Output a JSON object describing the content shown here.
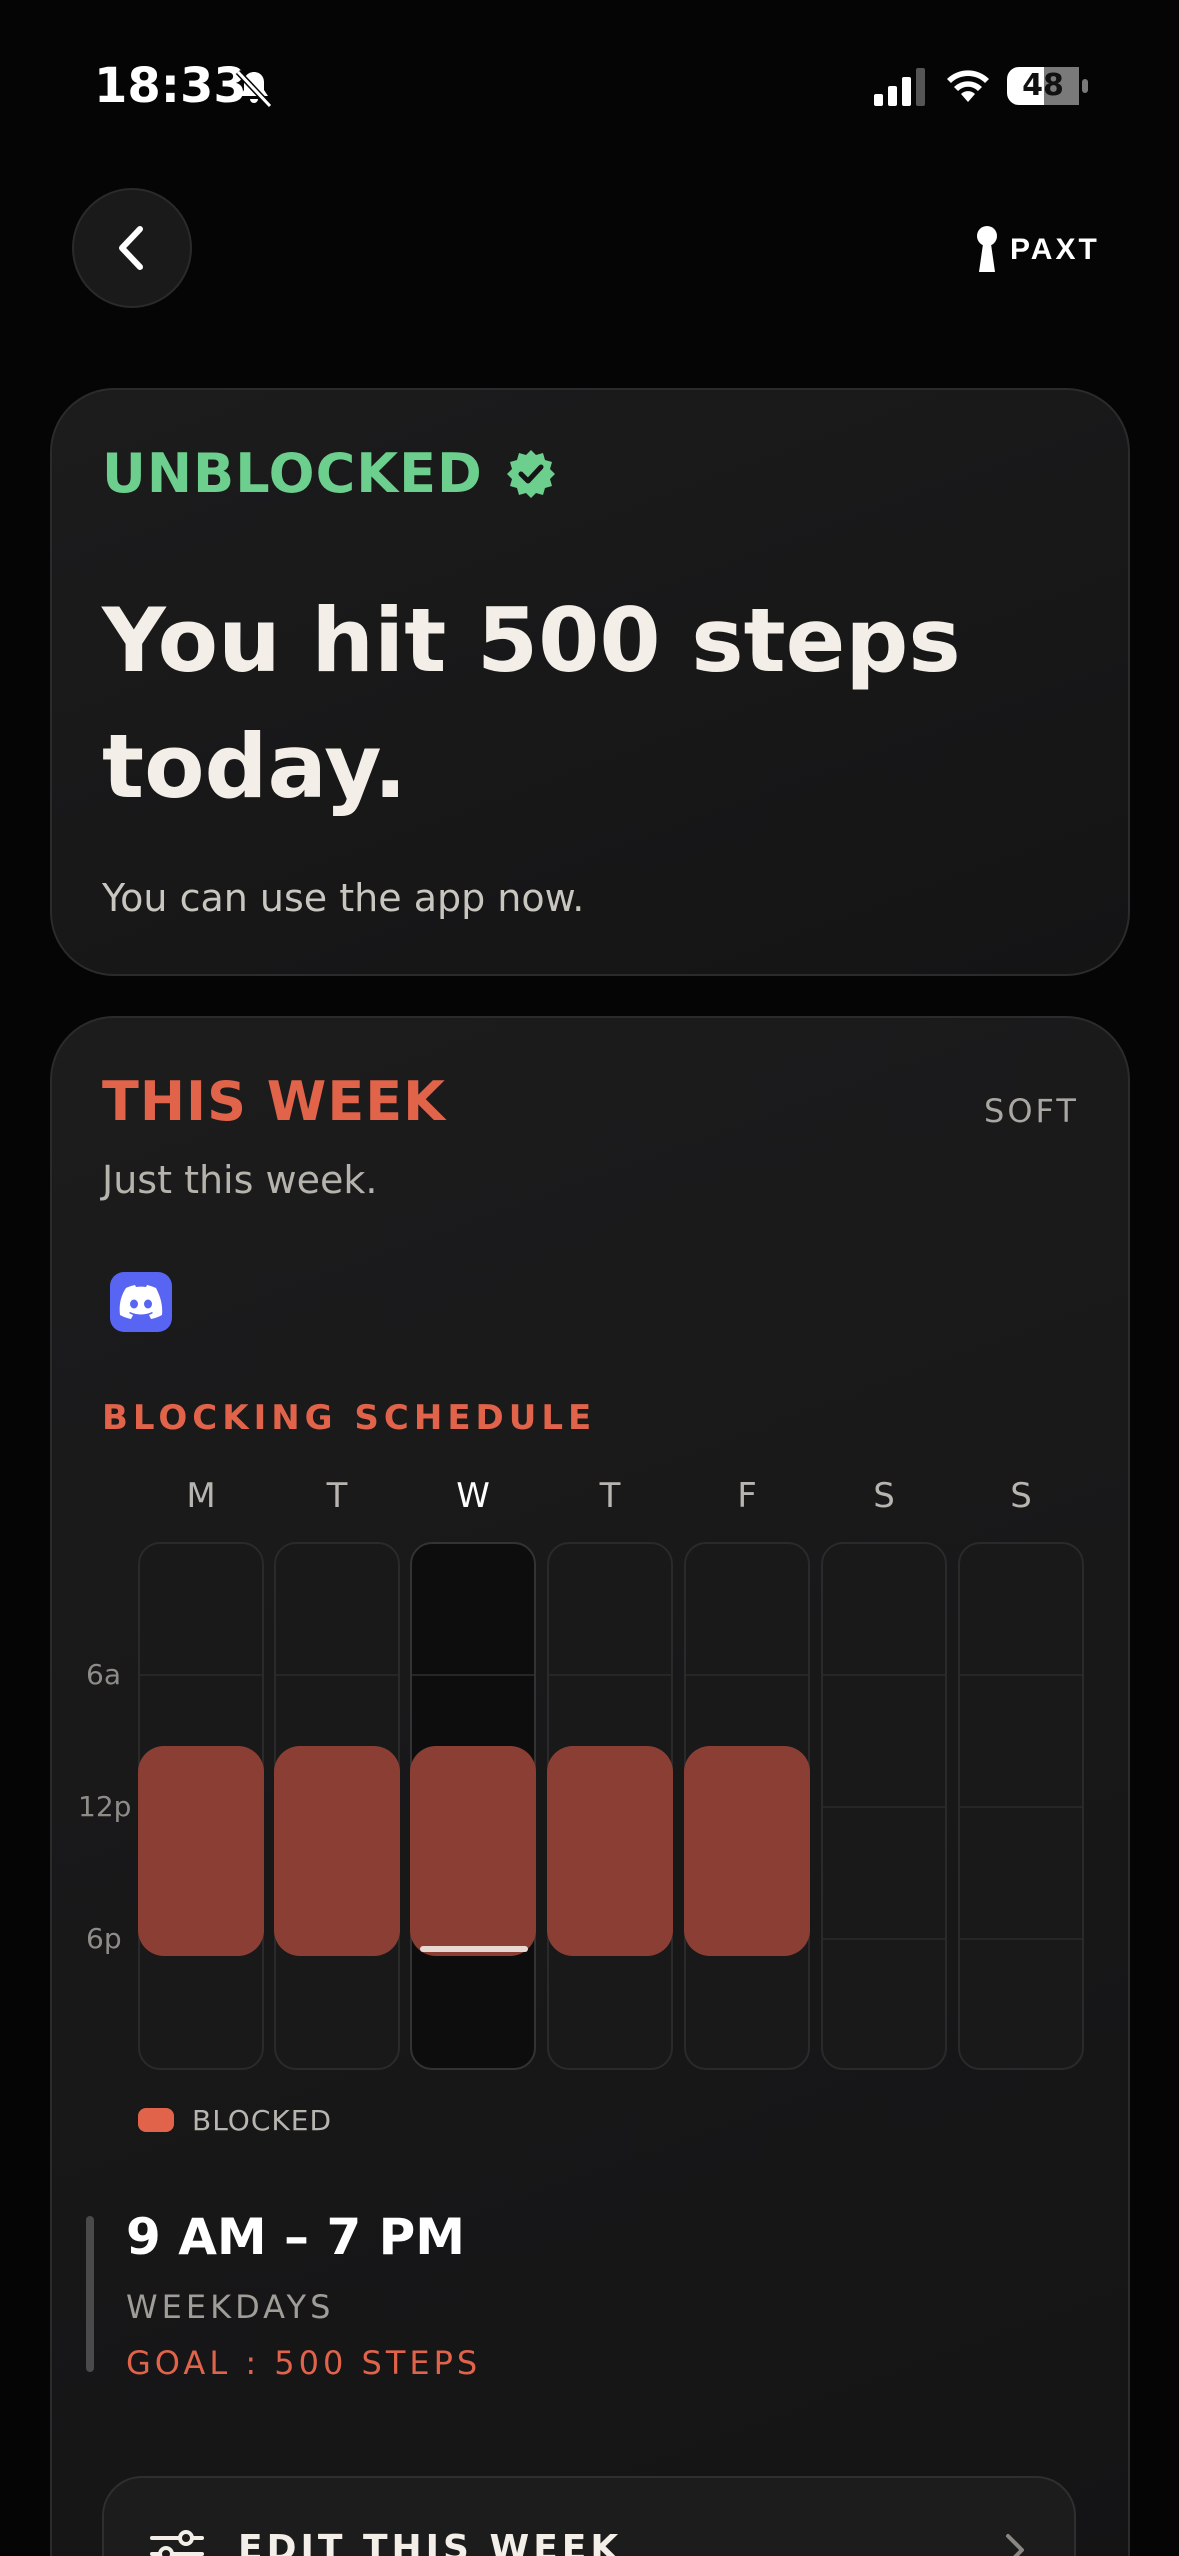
{
  "status_bar": {
    "time": "18:33",
    "battery": "48",
    "icons": [
      "bell-slash-icon",
      "signal-icon",
      "wifi-icon",
      "battery-icon"
    ]
  },
  "header": {
    "back_icon": "chevron-left-icon",
    "brand": "PAXT"
  },
  "unblocked_card": {
    "status": "UNBLOCKED",
    "status_icon": "verified-badge-icon",
    "headline": "You hit 500 steps today.",
    "subtext": "You can use the app now."
  },
  "week_card": {
    "title": "THIS WEEK",
    "mode": "SOFT",
    "subtitle": "Just this week.",
    "blocked_apps": [
      "discord-icon"
    ],
    "schedule_label": "BLOCKING SCHEDULE",
    "days": [
      "M",
      "T",
      "W",
      "T",
      "F",
      "S",
      "S"
    ],
    "today_index": 2,
    "time_labels": [
      "6a",
      "12p",
      "6p"
    ],
    "blocked_days": [
      true,
      true,
      true,
      true,
      true,
      false,
      false
    ],
    "legend": "BLOCKED",
    "rule": {
      "time_range": "9 AM – 7 PM",
      "days": "WEEKDAYS",
      "goal": "GOAL : 500 STEPS"
    },
    "edit_button": "EDIT THIS WEEK"
  },
  "colors": {
    "background": "#050505",
    "accent_green": "#6dcf8d",
    "accent_red": "#e0634a",
    "block_fill": "#8b3f34",
    "discord": "#5865f2"
  }
}
